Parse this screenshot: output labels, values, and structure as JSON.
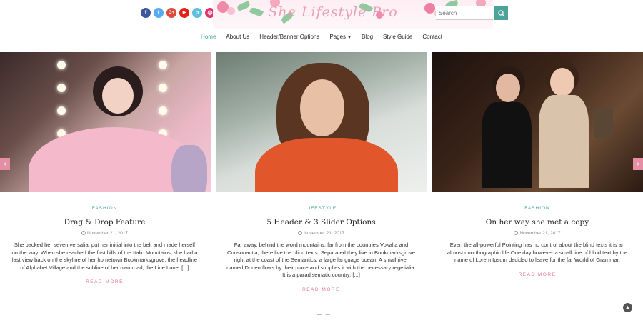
{
  "header": {
    "logo_text": "She Lifestyle Pro",
    "search_placeholder": "Search",
    "social": [
      {
        "icon": "facebook-icon",
        "glyph": "f",
        "color": "#3b5998"
      },
      {
        "icon": "twitter-icon",
        "glyph": "t",
        "color": "#55acee"
      },
      {
        "icon": "google-plus-icon",
        "glyph": "G+",
        "color": "#dd4b39"
      },
      {
        "icon": "youtube-icon",
        "glyph": "▶",
        "color": "#e62117"
      },
      {
        "icon": "pinterest-icon",
        "glyph": "p",
        "color": "#5bc0de"
      },
      {
        "icon": "instagram-icon",
        "glyph": "◎",
        "color": "#e1306c"
      }
    ]
  },
  "nav": {
    "items": [
      "Home",
      "About Us",
      "Header/Banner Options",
      "Pages",
      "Blog",
      "Style Guide",
      "Contact"
    ],
    "active": "Home"
  },
  "colors": {
    "accent": "#4ba39a",
    "pink": "#e07a93"
  },
  "posts": [
    {
      "category": "FASHION",
      "title": "Drag & Drop Feature",
      "date": "November 21, 2017",
      "excerpt": "She packed her seven versalia, put her initial into the belt and made herself on the way. When she reached the first hills of the Italic Mountains, she had a last view back on the skyline of her hometown Bookmarksgrove, the headline of Alphabet Village and the subline of her own road, the Line Lane. [...]",
      "read_more": "READ MORE"
    },
    {
      "category": "LIFESTYLE",
      "title": "5 Header & 3 Slider Options",
      "date": "November 21, 2017",
      "excerpt": "Far away, behind the word mountains, far from the countries Vokalia and Consonantia, there live the blind texts. Separated they live in Bookmarksgrove right at the coast of the Semantics, a large language ocean. A small river named Duden flows by their place and supplies it with the necessary regelialia. It is a paradisematic country, [...]",
      "read_more": "READ MORE"
    },
    {
      "category": "FASHION",
      "title": "On her way she met a copy",
      "date": "November 21, 2017",
      "excerpt": "Even the all-powerful Pointing has no control about the blind texts it is an almost unorthographic life One day however a small line of blind text by the name of Lorem Ipsum decided to leave for the far World of Grammar.",
      "read_more": "READ MORE"
    }
  ]
}
